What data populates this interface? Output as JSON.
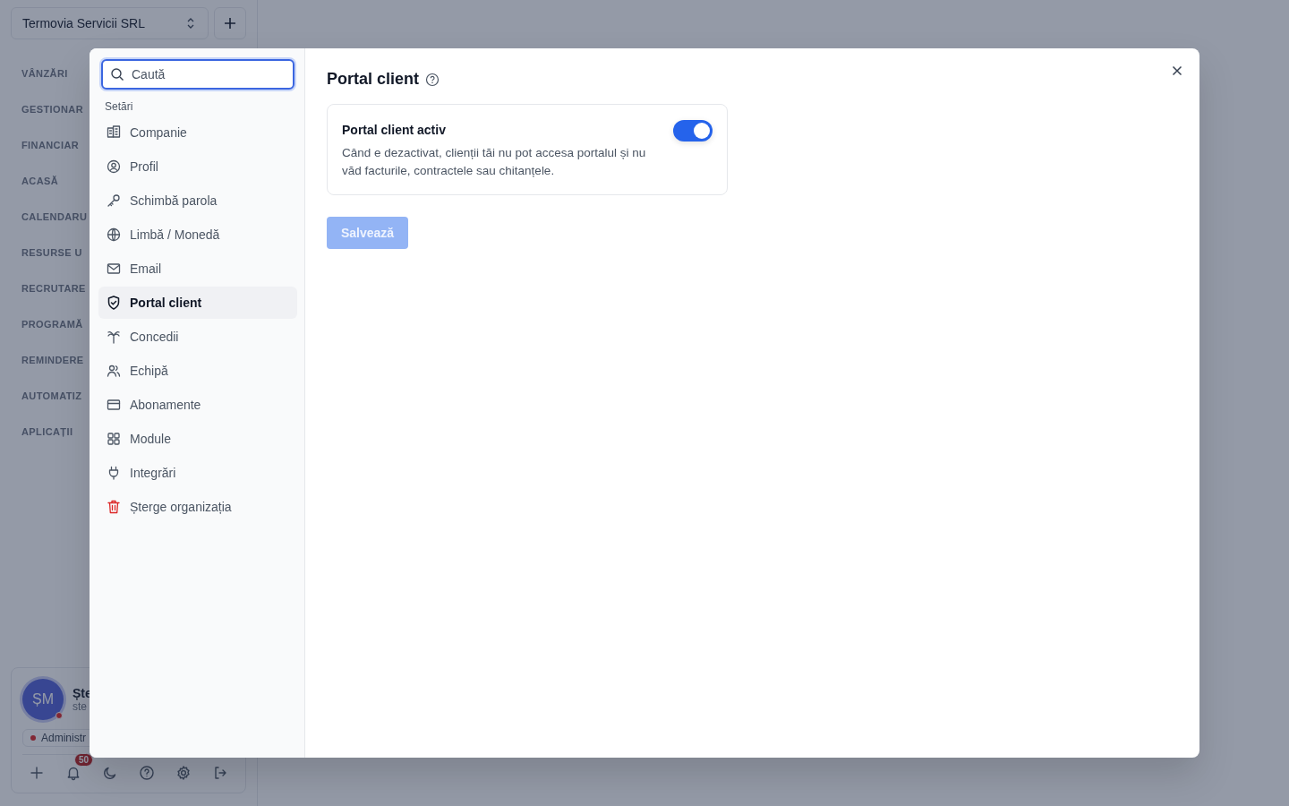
{
  "app": {
    "company_select": {
      "value": "Termovia Servicii SRL"
    },
    "nav": [
      {
        "label": "VÂNZĂRI"
      },
      {
        "label": "GESTIONAR"
      },
      {
        "label": "FINANCIAR"
      },
      {
        "label": "ACASĂ"
      },
      {
        "label": "CALENDARU"
      },
      {
        "label": "RESURSE U"
      },
      {
        "label": "RECRUTARE"
      },
      {
        "label": "PROGRAMĂ"
      },
      {
        "label": "REMINDERE"
      },
      {
        "label": "AUTOMATIZ"
      },
      {
        "label": "APLICAȚII"
      }
    ],
    "user": {
      "initials": "ȘM",
      "name": "Ște",
      "email": "ste",
      "role": "Administr",
      "online": false
    },
    "footer": {
      "notifications": "50"
    }
  },
  "settings_modal": {
    "search": {
      "placeholder": "Caută"
    },
    "section": "Setări",
    "items": [
      {
        "label": "Companie",
        "selected": false,
        "destructive": false
      },
      {
        "label": "Profil",
        "selected": false,
        "destructive": false
      },
      {
        "label": "Schimbă parola",
        "selected": false,
        "destructive": false
      },
      {
        "label": "Limbă / Monedă",
        "selected": false,
        "destructive": false
      },
      {
        "label": "Email",
        "selected": false,
        "destructive": false
      },
      {
        "label": "Portal client",
        "selected": true,
        "destructive": false
      },
      {
        "label": "Concedii",
        "selected": false,
        "destructive": false
      },
      {
        "label": "Echipă",
        "selected": false,
        "destructive": false
      },
      {
        "label": "Abonamente",
        "selected": false,
        "destructive": false
      },
      {
        "label": "Module",
        "selected": false,
        "destructive": false
      },
      {
        "label": "Integrări",
        "selected": false,
        "destructive": false
      },
      {
        "label": "Șterge organizația",
        "selected": false,
        "destructive": true
      }
    ],
    "title": "Portal client",
    "setting": {
      "label": "Portal client activ",
      "description": "Când e dezactivat, clienții tăi nu pot accesa portalul și nu văd facturile, contractele sau chitanțele.",
      "on": true
    },
    "save": {
      "label": "Salvează",
      "disabled": true
    }
  }
}
